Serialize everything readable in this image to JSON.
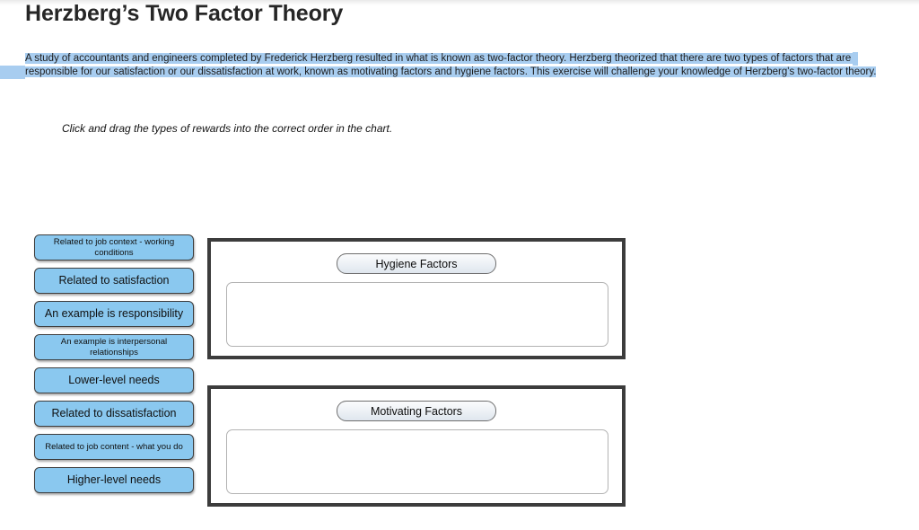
{
  "page": {
    "title": "Herzberg’s Two Factor Theory",
    "intro_line_1": "A study of accountants and engineers completed by Frederick Herzberg resulted in what is known as two-factor theory.  Herzberg theorized that there are two types of factors that are",
    "intro_line_2": "responsible for our satisfaction or our dissatisfaction at work, known as motivating factors and hygiene factors.  This exercise will challenge your knowledge of Herzberg's two-factor theory.",
    "instruction": "Click and drag the types of rewards into the correct order in the chart.",
    "highlight_color": "#a8cdf0",
    "tile_color": "#8ac8ef",
    "frame_border_color": "#3c3c3c"
  },
  "tiles": [
    {
      "label": "Related to job context - working conditions",
      "lines": 2
    },
    {
      "label": "Related to satisfaction",
      "lines": 1
    },
    {
      "label": "An example is responsibility",
      "lines": 1
    },
    {
      "label": "An example is interpersonal relationships",
      "lines": 2
    },
    {
      "label": "Lower-level needs",
      "lines": 1
    },
    {
      "label": "Related to dissatisfaction",
      "lines": 1
    },
    {
      "label": "Related to job content - what you do",
      "lines": 2
    },
    {
      "label": "Higher-level needs",
      "lines": 1
    }
  ],
  "categories": [
    {
      "title": "Hygiene Factors",
      "dropped": []
    },
    {
      "title": "Motivating Factors",
      "dropped": []
    }
  ]
}
